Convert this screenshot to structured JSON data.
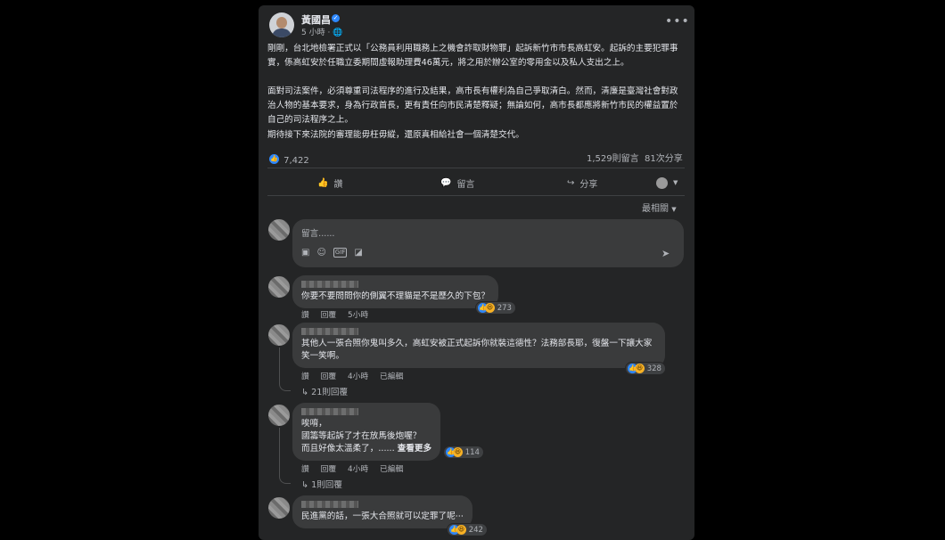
{
  "post": {
    "author": "黃國昌",
    "time": "5 小時 ·",
    "paragraphs": [
      "剛剛，台北地檢署正式以「公務員利用職務上之機會詐取財物罪」起訴新竹市市長高虹安。起訴的主要犯罪事實，係高虹安於任職立委期間虛報助理費46萬元，將之用於辦公室的零用金以及私人支出之上。",
      "面對司法案件，必須尊重司法程序的進行及結果，高市長有權利為自己爭取清白。然而，清廉是臺灣社會對政治人物的基本要求，身為行政首長，更有責任向市民清楚釋疑；無論如何，高市長都應將新竹市民的權益置於自己的司法程序之上。",
      "期待接下來法院的審理能毋枉毋縱，還原真相給社會一個清楚交代。"
    ],
    "reaction_count": "7,422",
    "comment_count": "1,529則留言",
    "share_count": "81次分享",
    "actions": {
      "like": "讚",
      "comment": "留言",
      "share": "分享"
    },
    "sort_label": "最相關"
  },
  "composer": {
    "placeholder": "留言......"
  },
  "comments": [
    {
      "text": "你要不要問問你的側翼不理貓是不是歷久的下包？",
      "like": "讚",
      "reply": "回覆",
      "time": "5小時",
      "edited": "",
      "reactions": "273",
      "replies": ""
    },
    {
      "text": "其他人一張合照你鬼叫多久，高虹安被正式起訴你就裝這德性？法務部長耶，復盤一下讓大家笑一笑啊。",
      "like": "讚",
      "reply": "回覆",
      "time": "4小時",
      "edited": "已編輯",
      "reactions": "328",
      "replies": "21則回覆"
    },
    {
      "line1": "唉唷，",
      "line2": "國籌等起訴了才在放馬後炮喔？",
      "line3": "而且好像太溫柔了，......",
      "see_more": "查看更多",
      "like": "讚",
      "reply": "回覆",
      "time": "4小時",
      "edited": "已編輯",
      "reactions": "114",
      "replies": "1則回覆"
    },
    {
      "text": "民進黨的話，一張大合照就可以定罪了呢⋯",
      "reactions": "242"
    }
  ],
  "colors": {
    "background": "#000000",
    "card": "#242526",
    "bubble": "#3a3b3c",
    "accent": "#2d88ff"
  }
}
